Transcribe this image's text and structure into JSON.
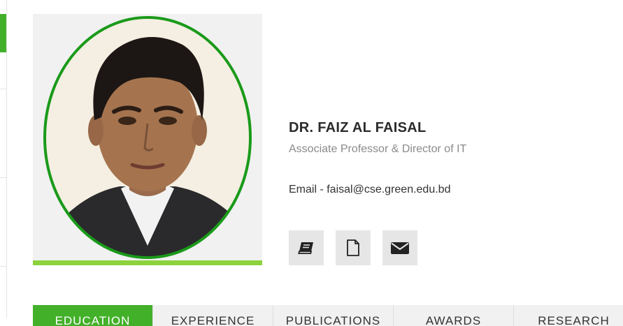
{
  "profile": {
    "name": "DR. FAIZ AL FAISAL",
    "title": "Associate Professor & Director of IT",
    "email_line": "Email - faisal@cse.green.edu.bd"
  },
  "action_icons": [
    {
      "icon": "book-icon"
    },
    {
      "icon": "document-icon"
    },
    {
      "icon": "envelope-icon"
    }
  ],
  "tabs": [
    {
      "label": "EDUCATION",
      "active": true
    },
    {
      "label": "EXPERIENCE",
      "active": false
    },
    {
      "label": "PUBLICATIONS",
      "active": false
    },
    {
      "label": "AWARDS",
      "active": false
    },
    {
      "label": "RESEARCH",
      "active": false
    }
  ],
  "colors": {
    "accent_green": "#43b02a",
    "strip_green": "#8cd23c",
    "portrait_ring": "#1a9a1a"
  }
}
